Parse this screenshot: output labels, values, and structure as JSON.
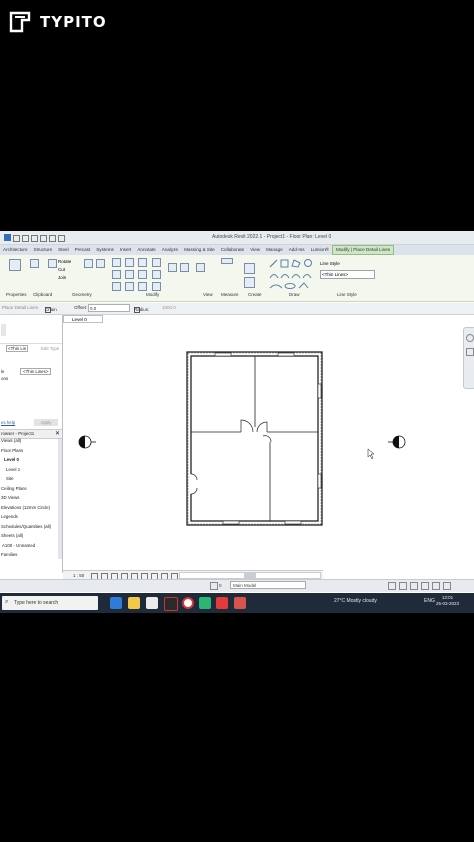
{
  "overlay": {
    "brand": "TYPITO"
  },
  "app": {
    "title": "Autodesk Revit 2022.1 - Project1 - Floor Plan: Level 0",
    "ribbon_tabs": [
      "Architecture",
      "Structure",
      "Steel",
      "Precast",
      "Systems",
      "Insert",
      "Annotate",
      "Analyze",
      "Massing & Site",
      "Collaborate",
      "View",
      "Manage",
      "Add-Ins",
      "Lumion®",
      "Modify | Place Detail Lines"
    ],
    "active_tab": "Modify | Place Detail Lines",
    "ribbon": {
      "modify_buttons": [
        "Rotate",
        "Cut",
        "Join"
      ],
      "line_style_label": "Line Style",
      "line_style_value": "<Thin Lines>",
      "panel_labels": [
        "Properties",
        "Clipboard",
        "Geometry",
        "Modify",
        "View",
        "Measure",
        "Create",
        "Draw",
        "Line Style"
      ]
    },
    "options_bar": {
      "context": "Place Detail Lines",
      "chain_label": "Chain",
      "offset_label": "Offset:",
      "offset_value": "0.0",
      "radius_label": "Radius:",
      "radius_value": "1000.0"
    },
    "properties": {
      "type_value": "<Thin Lin",
      "edit_type": "Edit Type",
      "style_label": "le",
      "style_value": "<Thin Lines>",
      "row2_label": "ons",
      "help_link": "es help",
      "apply": "Apply"
    },
    "project_browser": {
      "title": "rowser - Project1",
      "items": [
        "Views (all)",
        "Floor Plans",
        "Level 0",
        "Level 1",
        "Site",
        "Ceiling Plans",
        "3D Views",
        "Elevations (12mm Circle)",
        "Legends",
        "Schedules/Quantities (all)",
        "Sheets (all)",
        "A100 - Unnamed",
        "Families"
      ]
    },
    "view_tab": "Level 0",
    "view_controls": {
      "scale": "1 : 50"
    },
    "status": {
      "model": "Main Model",
      "workset_value": "0"
    },
    "taskbar": {
      "search_placeholder": "Type here to search",
      "weather": "27°C  Mostly cloudy",
      "lang": "ENG",
      "time": "13:01",
      "date": "25-03-2023"
    }
  },
  "colors": {
    "ribbon_active": "#cfe6c6",
    "taskbar": "#1f2a3a",
    "background": "#000000"
  }
}
